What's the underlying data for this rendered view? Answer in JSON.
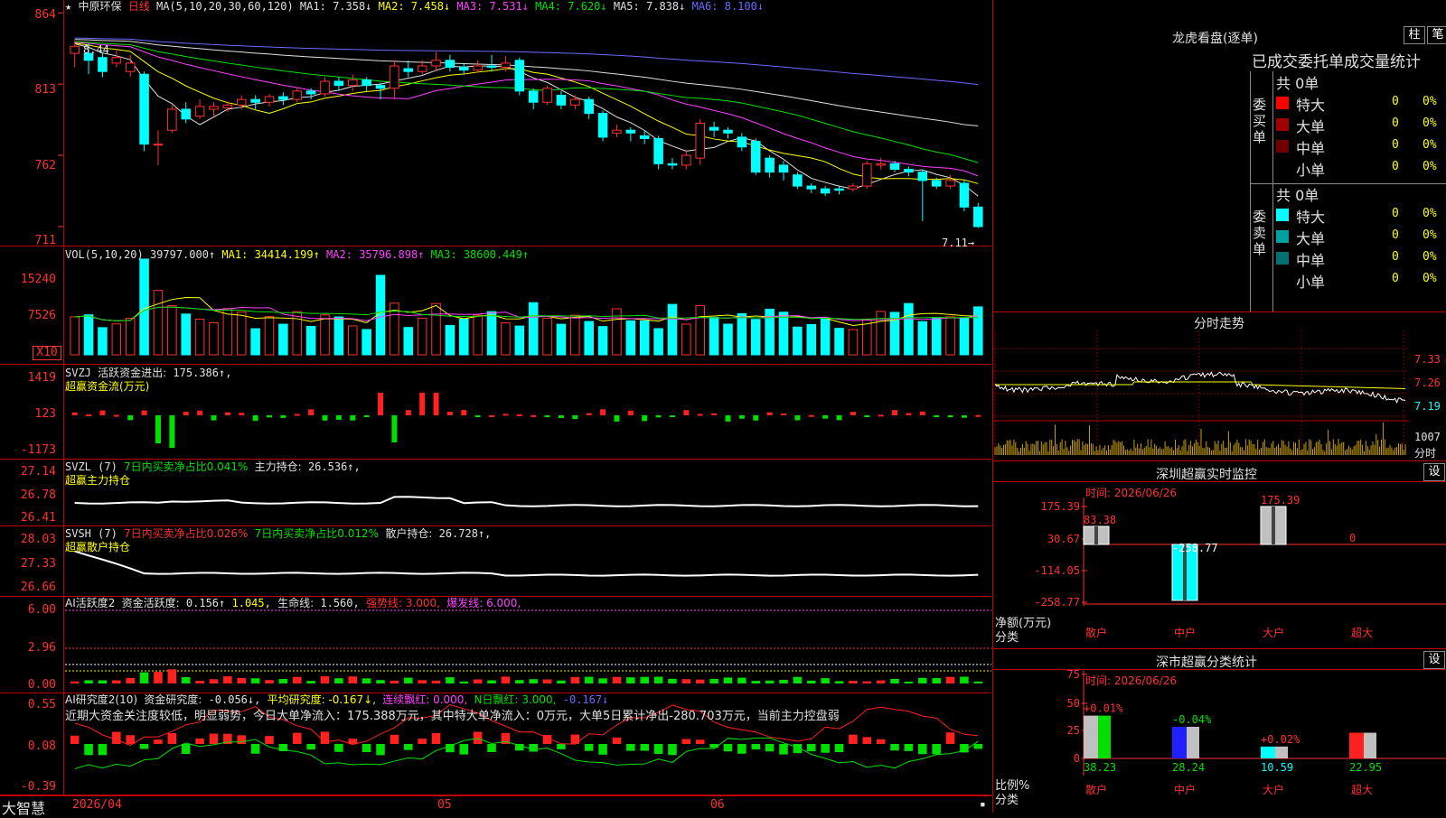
{
  "stock": {
    "marker": "★",
    "name": "中原环保",
    "period": "日线"
  },
  "colors": {
    "up": "#ff3030",
    "down": "#00ffff",
    "ma1": "#e0e0e0",
    "ma2": "#ffff00",
    "ma3": "#ff40ff",
    "ma4": "#00e000",
    "ma5": "#e0e0e0",
    "ma6": "#6a6aff"
  },
  "price_panel": {
    "ma_title": "MA(5,10,20,30,60,120)",
    "ma_values": [
      {
        "label": "MA1:",
        "value": "7.358↓"
      },
      {
        "label": "MA2:",
        "value": "7.458↓"
      },
      {
        "label": "MA3:",
        "value": "7.531↓"
      },
      {
        "label": "MA4:",
        "value": "7.620↓"
      },
      {
        "label": "MA5:",
        "value": "7.838↓"
      },
      {
        "label": "MA6:",
        "value": "8.100↓"
      }
    ],
    "ticks": [
      "864",
      "813",
      "762",
      "711"
    ],
    "high_label": "8.44",
    "low_label": "7.11→"
  },
  "chart_data": {
    "type": "candlestick",
    "ylim": [
      7.0,
      8.68
    ],
    "candles": [
      [
        8.35,
        8.4,
        8.25,
        8.44
      ],
      [
        8.35,
        8.3,
        8.2,
        8.42
      ],
      [
        8.32,
        8.22,
        8.18,
        8.36
      ],
      [
        8.28,
        8.32,
        8.25,
        8.38
      ],
      [
        8.22,
        8.28,
        8.18,
        8.34
      ],
      [
        8.2,
        7.7,
        7.65,
        8.22
      ],
      [
        7.7,
        7.7,
        7.55,
        7.8
      ],
      [
        7.8,
        7.95,
        7.78,
        7.98
      ],
      [
        7.95,
        7.88,
        7.85,
        8.0
      ],
      [
        7.9,
        7.97,
        7.88,
        8.02
      ],
      [
        7.95,
        7.97,
        7.9,
        8.0
      ],
      [
        7.96,
        7.98,
        7.93,
        8.01
      ],
      [
        7.98,
        8.02,
        7.95,
        8.05
      ],
      [
        8.02,
        8.0,
        7.95,
        8.05
      ],
      [
        8.0,
        8.04,
        7.97,
        8.06
      ],
      [
        8.04,
        8.02,
        7.98,
        8.07
      ],
      [
        8.02,
        8.08,
        8.0,
        8.1
      ],
      [
        8.08,
        8.06,
        8.02,
        8.1
      ],
      [
        8.06,
        8.15,
        8.04,
        8.18
      ],
      [
        8.15,
        8.12,
        8.08,
        8.18
      ],
      [
        8.12,
        8.16,
        8.08,
        8.2
      ],
      [
        8.16,
        8.12,
        8.08,
        8.18
      ],
      [
        8.12,
        8.1,
        8.02,
        8.14
      ],
      [
        8.1,
        8.26,
        8.02,
        8.3
      ],
      [
        8.24,
        8.22,
        8.18,
        8.3
      ],
      [
        8.22,
        8.26,
        8.2,
        8.3
      ],
      [
        8.26,
        8.3,
        8.22,
        8.36
      ],
      [
        8.3,
        8.25,
        8.22,
        8.34
      ],
      [
        8.25,
        8.23,
        8.2,
        8.28
      ],
      [
        8.23,
        8.26,
        8.21,
        8.3
      ],
      [
        8.26,
        8.25,
        8.22,
        8.34
      ],
      [
        8.25,
        8.28,
        8.22,
        8.33
      ],
      [
        8.3,
        8.08,
        8.05,
        8.32
      ],
      [
        8.08,
        8.0,
        7.95,
        8.1
      ],
      [
        8.0,
        8.1,
        7.98,
        8.12
      ],
      [
        8.05,
        7.98,
        7.95,
        8.08
      ],
      [
        7.98,
        8.02,
        7.95,
        8.05
      ],
      [
        8.02,
        7.92,
        7.88,
        8.04
      ],
      [
        7.92,
        7.75,
        7.72,
        7.94
      ],
      [
        7.78,
        7.8,
        7.75,
        7.84
      ],
      [
        7.8,
        7.78,
        7.72,
        7.82
      ],
      [
        7.76,
        7.74,
        7.7,
        7.8
      ],
      [
        7.74,
        7.56,
        7.52,
        7.76
      ],
      [
        7.56,
        7.55,
        7.52,
        7.6
      ],
      [
        7.55,
        7.62,
        7.52,
        7.66
      ],
      [
        7.6,
        7.85,
        7.55,
        7.88
      ],
      [
        7.82,
        7.8,
        7.75,
        7.86
      ],
      [
        7.8,
        7.78,
        7.74,
        7.82
      ],
      [
        7.75,
        7.68,
        7.65,
        7.78
      ],
      [
        7.72,
        7.5,
        7.48,
        7.74
      ],
      [
        7.6,
        7.5,
        7.46,
        7.62
      ],
      [
        7.55,
        7.5,
        7.44,
        7.58
      ],
      [
        7.48,
        7.4,
        7.38,
        7.5
      ],
      [
        7.4,
        7.38,
        7.35,
        7.42
      ],
      [
        7.38,
        7.35,
        7.33,
        7.4
      ],
      [
        7.38,
        7.37,
        7.34,
        7.4
      ],
      [
        7.38,
        7.4,
        7.36,
        7.42
      ],
      [
        7.4,
        7.56,
        7.38,
        7.58
      ],
      [
        7.55,
        7.56,
        7.52,
        7.6
      ],
      [
        7.56,
        7.52,
        7.5,
        7.58
      ],
      [
        7.52,
        7.5,
        7.47,
        7.54
      ],
      [
        7.5,
        7.44,
        7.15,
        7.52
      ],
      [
        7.44,
        7.4,
        7.38,
        7.46
      ],
      [
        7.4,
        7.44,
        7.38,
        7.48
      ],
      [
        7.42,
        7.25,
        7.22,
        7.44
      ],
      [
        7.25,
        7.11,
        7.1,
        7.28
      ]
    ]
  },
  "vol_panel": {
    "title": "VOL(5,10,20)",
    "value": "39797.000↑",
    "mas": [
      {
        "label": "MA1:",
        "value": "34414.199↑"
      },
      {
        "label": "MA2:",
        "value": "35796.898↑"
      },
      {
        "label": "MA3:",
        "value": "38600.449↑"
      }
    ],
    "ticks": [
      "15240",
      "7526"
    ],
    "unit": "X10"
  },
  "svzj_panel": {
    "title": "SVZJ",
    "label": "活跃资金进出:",
    "value": "175.386↑,",
    "subtitle": "超赢资金流(万元)",
    "ticks": [
      "1419",
      "123",
      "-1173"
    ]
  },
  "svzl_panel": {
    "title": "SVZL (7)",
    "label1": "7日内买卖净占比0.041%",
    "label2": "主力持仓:",
    "value": "26.536↑,",
    "subtitle": "超赢主力持仓",
    "ticks": [
      "27.14",
      "26.78",
      "26.41"
    ]
  },
  "svsh_panel": {
    "title": "SVSH (7)",
    "label1": "7日内买卖净占比0.026%",
    "label2": "7日内买卖净占比0.012%",
    "label3": "散户持仓:",
    "value": "26.728↑,",
    "subtitle": "超赢散户持仓",
    "ticks": [
      "28.03",
      "27.33",
      "26.66"
    ]
  },
  "ai_active": {
    "title": "AI活跃度2",
    "label": "资金活跃度:",
    "value1": "0.156↑",
    "value2": "1.045,",
    "life_label": "生命线:",
    "life_value": "1.560,",
    "strong": "强势线: 3.000,",
    "burst": "爆发线: 6.000,",
    "ticks": [
      "6.00",
      "2.96",
      "0.00"
    ]
  },
  "ai_research": {
    "title": "AI研究度2(10)",
    "label": "资金研究度:",
    "value": "-0.056↓,",
    "avg": "平均研究度: -0.167↓,",
    "streak": "连续飘红: 0.000,",
    "nday": "N日飘红: 3.000,",
    "last": "-0.167↓",
    "comment": "近期大资金关注度较低，明显弱势，今日大单净流入：175.388万元，其中特大单净流入：0万元，大单5日累计净出-280.703万元，当前主力控盘弱",
    "ticks": [
      "0.55",
      "0.08",
      "-0.39"
    ]
  },
  "bottom_bar": {
    "logo": "大智慧",
    "dates": [
      "2026/04",
      "05",
      "06"
    ]
  },
  "dragon_tiger": {
    "title": "龙虎看盘(逐单)",
    "btn1": "柱",
    "btn2": "笔",
    "header": "已成交委托单成交量统计",
    "buy": {
      "side": "委买单",
      "total": "共 0单",
      "rows": [
        {
          "name": "特大",
          "count": "0",
          "pct": "0%",
          "color": "#ff0000"
        },
        {
          "name": "大单",
          "count": "0",
          "pct": "0%",
          "color": "#a00000"
        },
        {
          "name": "中单",
          "count": "0",
          "pct": "0%",
          "color": "#700000"
        },
        {
          "name": "小单",
          "count": "0",
          "pct": "0%",
          "color": ""
        }
      ]
    },
    "sell": {
      "side": "委卖单",
      "total": "共 0单",
      "rows": [
        {
          "name": "特大",
          "count": "0",
          "pct": "0%",
          "color": "#00ffff"
        },
        {
          "name": "大单",
          "count": "0",
          "pct": "0%",
          "color": "#00a0a0"
        },
        {
          "name": "中单",
          "count": "0",
          "pct": "0%",
          "color": "#007070"
        },
        {
          "name": "小单",
          "count": "0",
          "pct": "0%",
          "color": ""
        }
      ]
    }
  },
  "intraday": {
    "title": "分时走势",
    "prices": [
      "7.33",
      "7.26",
      "7.19"
    ],
    "vol_label": "1007",
    "vol_unit": "分时"
  },
  "sz_monitor": {
    "title": "深圳超赢实时监控",
    "btn": "设",
    "time": "时间: 2026/06/26",
    "ticks": [
      "175.39",
      "30.67",
      "-114.05",
      "-258.77"
    ],
    "unit": "净额(万元)",
    "cat": "分类",
    "bars": [
      {
        "name": "散户",
        "value": 83.38,
        "label": "83.38"
      },
      {
        "name": "中户",
        "value": -258.77,
        "label": "-258.77"
      },
      {
        "name": "大户",
        "value": 175.39,
        "label": "175.39"
      },
      {
        "name": "超大",
        "value": 0,
        "label": "0"
      }
    ]
  },
  "sz_classify": {
    "title": "深市超赢分类统计",
    "btn": "设",
    "time": "时间: 2026/06/26",
    "ticks": [
      "75",
      "50",
      "25",
      "0"
    ],
    "unit": "比例%",
    "cat": "分类",
    "bars": [
      {
        "name": "散户",
        "value": 38.23,
        "label": "38.23",
        "delta": "+0.01%"
      },
      {
        "name": "中户",
        "value": 28.24,
        "label": "28.24",
        "delta": "-0.04%"
      },
      {
        "name": "大户",
        "value": 10.59,
        "label": "10.59",
        "delta": "+0.02%"
      },
      {
        "name": "超大",
        "value": 22.95,
        "label": "22.95",
        "delta": ""
      }
    ]
  }
}
